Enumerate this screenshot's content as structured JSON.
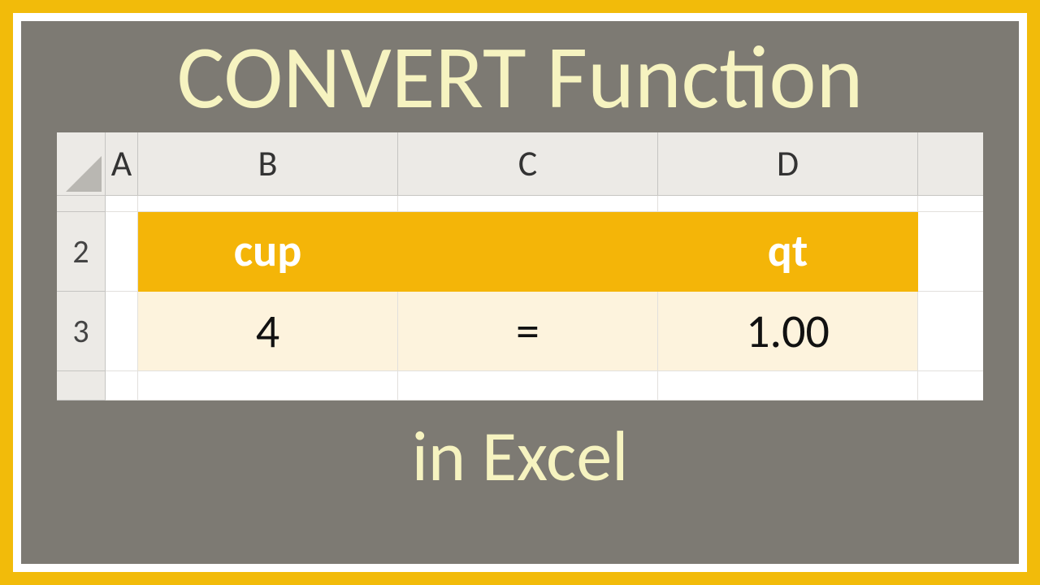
{
  "title_top": "CONVERT Function",
  "title_bottom": "in Excel",
  "columns": {
    "A": "A",
    "B": "B",
    "C": "C",
    "D": "D"
  },
  "rows": {
    "r2": "2",
    "r3": "3"
  },
  "cells": {
    "B2": "cup",
    "D2": "qt",
    "B3": "4",
    "C3": "=",
    "D3": "1.00"
  },
  "colors": {
    "frame": "#f2bb0a",
    "panel": "#7d7a73",
    "orange": "#f4b508",
    "cream": "#fdf3dd",
    "titleText": "#f6f3c0"
  }
}
